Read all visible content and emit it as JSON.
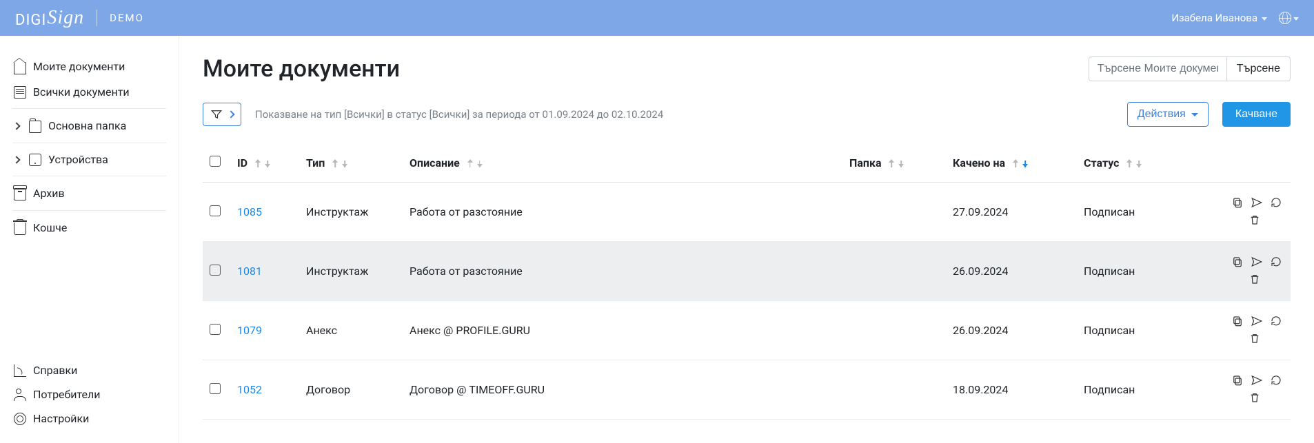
{
  "brand": {
    "name_prefix": "DIGI",
    "name_script": "Sign",
    "demo": "DEMO"
  },
  "user": {
    "name": "Изабела Иванова"
  },
  "sidebar": {
    "items": [
      {
        "label": "Моите документи"
      },
      {
        "label": "Всички документи"
      },
      {
        "label": "Основна папка"
      },
      {
        "label": "Устройства"
      },
      {
        "label": "Архив"
      },
      {
        "label": "Кошче"
      },
      {
        "label": "Справки"
      },
      {
        "label": "Потребители"
      },
      {
        "label": "Настройки"
      }
    ]
  },
  "page": {
    "title": "Моите документи",
    "search_placeholder": "Търсене Моите документи",
    "search_button": "Търсене"
  },
  "toolbar": {
    "filter_summary": "Показване на тип [Всички] в статус [Всички] за периода от 01.09.2024 до 02.10.2024",
    "actions_label": "Действия",
    "upload_label": "Качване"
  },
  "table": {
    "headers": {
      "id": "ID",
      "type": "Тип",
      "description": "Описание",
      "folder": "Папка",
      "uploaded": "Качено на",
      "status": "Статус"
    },
    "rows": [
      {
        "id": "1085",
        "type": "Инструктаж",
        "description": "Работа от разстояние",
        "folder": "",
        "uploaded": "27.09.2024",
        "status": "Подписан"
      },
      {
        "id": "1081",
        "type": "Инструктаж",
        "description": "Работа от разстояние",
        "folder": "",
        "uploaded": "26.09.2024",
        "status": "Подписан"
      },
      {
        "id": "1079",
        "type": "Анекс",
        "description": "Анекс @ PROFILE.GURU",
        "folder": "",
        "uploaded": "26.09.2024",
        "status": "Подписан"
      },
      {
        "id": "1052",
        "type": "Договор",
        "description": "Договор @ TIMEOFF.GURU",
        "folder": "",
        "uploaded": "18.09.2024",
        "status": "Подписан"
      }
    ]
  }
}
